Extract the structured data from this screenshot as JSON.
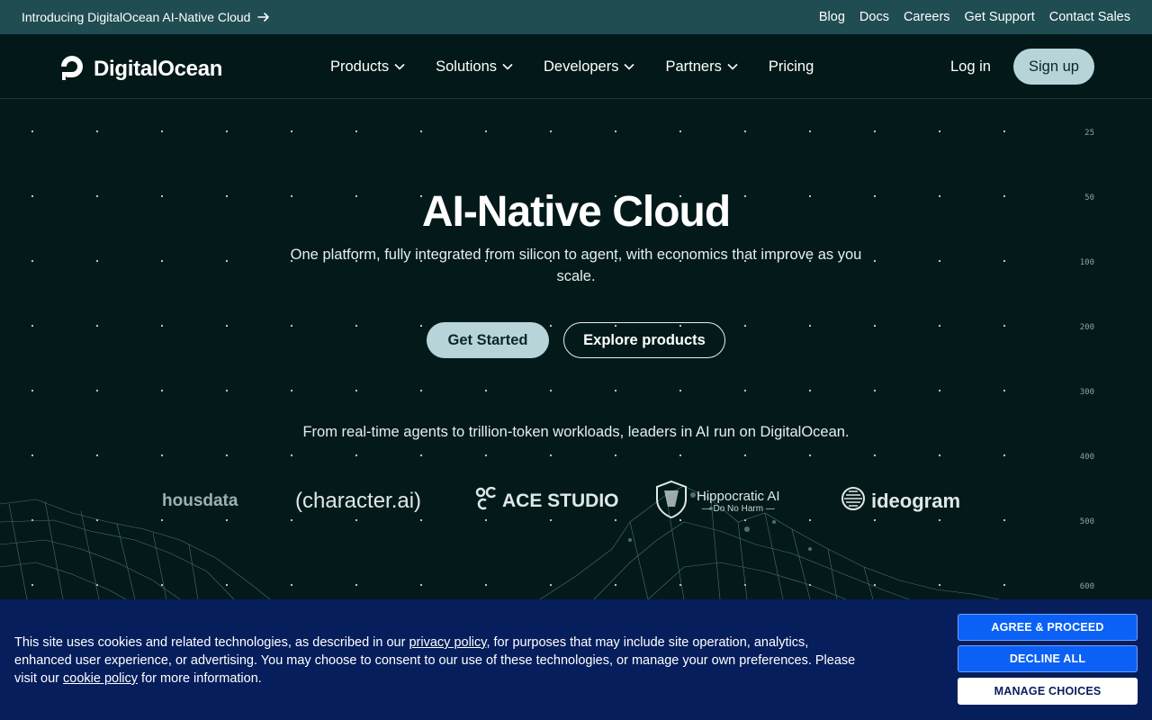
{
  "announcement": {
    "text": "Introducing DigitalOcean AI-Native Cloud",
    "links": [
      "Blog",
      "Docs",
      "Careers",
      "Get Support",
      "Contact Sales"
    ]
  },
  "header": {
    "brand": "DigitalOcean",
    "nav": [
      "Products",
      "Solutions",
      "Developers",
      "Partners",
      "Pricing"
    ],
    "login": "Log in",
    "signup": "Sign up"
  },
  "hero": {
    "title": "AI-Native Cloud",
    "subtitle": "One platform, fully integrated from silicon to agent, with economics that improve as you scale.",
    "primary_cta": "Get Started",
    "secondary_cta": "Explore products",
    "leaders_text": "From real-time agents to trillion-token workloads, leaders in AI run on DigitalOcean."
  },
  "customers": {
    "housdata": "housdata",
    "character": "(character.ai)",
    "ace": "ACE STUDIO",
    "hippocratic_name": "Hippocratic AI",
    "hippocratic_tag": "— Do No Harm —",
    "ideogram": "ideogram"
  },
  "scale_labels": [
    "25",
    "50",
    "100",
    "200",
    "300",
    "400",
    "500",
    "600"
  ],
  "cookie": {
    "text_before_privacy": "This site uses cookies and related technologies, as described in our ",
    "privacy_link": "privacy policy",
    "text_middle": ", for purposes that may include site operation, analytics, enhanced user experience, or advertising. You may choose to consent to our use of these technologies, or manage your own preferences. Please visit our ",
    "cookie_link": "cookie policy",
    "text_after": " for more information.",
    "agree": "AGREE & PROCEED",
    "decline": "DECLINE ALL",
    "manage": "MANAGE CHOICES"
  },
  "colors": {
    "background": "#041a1a",
    "announcement_bar": "#1f4d52",
    "accent_button": "#b7d5d9",
    "cookie_banner": "#061e5c",
    "cookie_button": "#0b61f5"
  }
}
